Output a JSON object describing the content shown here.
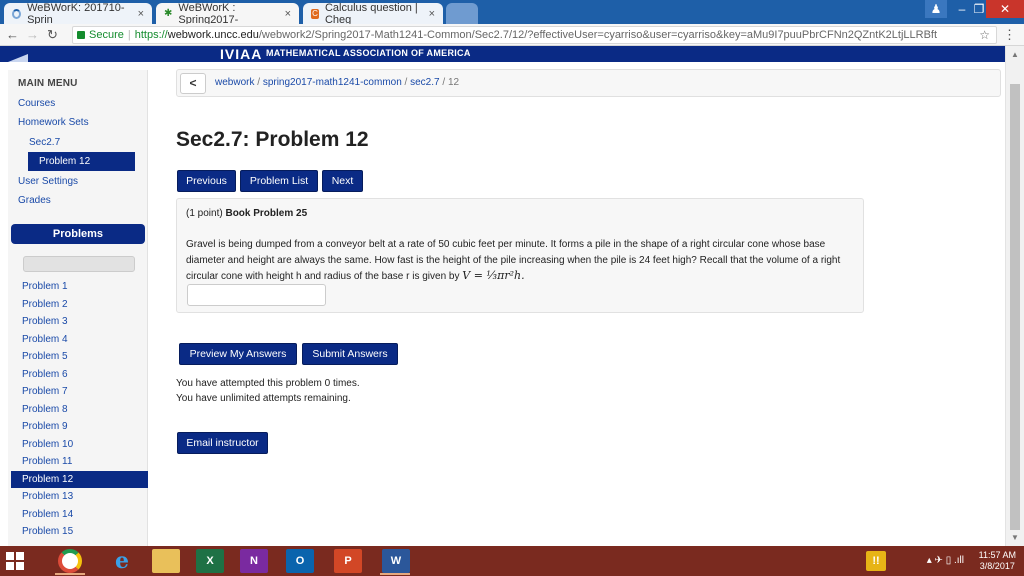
{
  "browser": {
    "tabs": [
      {
        "label": "WeBWorK: 201710-Sprin",
        "close": "×"
      },
      {
        "label": "WeBWorK : Spring2017-",
        "close": "×"
      },
      {
        "label": "Calculus question | Cheg",
        "close": "×"
      }
    ],
    "address": {
      "secure_label": "Secure",
      "separator": "|",
      "url_scheme": "https://",
      "url_host": "webwork.uncc.edu",
      "url_path": "/webwork2/Spring2017-Math1241-Common/Sec2.7/12/?effectiveUser=cyarriso&user=cyarriso&key=aMu9I7puuPbrCFNn2QZntK2LtjLLRBft"
    },
    "nav_icons": [
      "back-icon",
      "forward-icon",
      "reload-icon"
    ]
  },
  "banner": {
    "logo_text": "IVIAA",
    "text": "MATHEMATICAL ASSOCIATION OF AMERICA"
  },
  "sidebar": {
    "title": "MAIN MENU",
    "courses": "Courses",
    "homework_sets": "Homework Sets",
    "sec": "Sec2.7",
    "current_problem": "Problem 12",
    "user_settings": "User Settings",
    "grades": "Grades",
    "problems_header": "Problems",
    "problem_list": [
      "Problem 1",
      "Problem 2",
      "Problem 3",
      "Problem 4",
      "Problem 5",
      "Problem 6",
      "Problem 7",
      "Problem 8",
      "Problem 9",
      "Problem 10",
      "Problem 11",
      "Problem 12",
      "Problem 13",
      "Problem 14",
      "Problem 15"
    ],
    "active_index": 11
  },
  "main": {
    "breadcrumb": {
      "back": "<",
      "webwork": "webwork",
      "sep": " / ",
      "course": "spring2017-math1241-common",
      "set": "sec2.7",
      "problem": "12"
    },
    "title": "Sec2.7: Problem 12",
    "buttons": {
      "previous": "Previous",
      "problem_list": "Problem List",
      "next": "Next",
      "preview": "Preview My Answers",
      "submit": "Submit Answers",
      "email": "Email instructor"
    },
    "problem": {
      "points": "(1 point)",
      "source": "Book Problem 25",
      "text": "Gravel is being dumped from a conveyor belt at a rate of 50 cubic feet per minute. It forms a pile in the shape of a right circular cone whose base diameter and height are always the same. How fast is the height of the pile increasing when the pile is 24 feet high? Recall that the volume of a right circular cone with height h and radius of the base r is given by",
      "formula": "V = ⅓πr²h.",
      "answer_value": ""
    },
    "attempts": "You have attempted this problem 0 times.",
    "remaining": "You have unlimited attempts remaining."
  },
  "taskbar": {
    "time": "11:57 AM",
    "date": "3/8/2017",
    "apps": [
      "chrome-icon",
      "ie-icon",
      "file-explorer-icon",
      "excel-icon",
      "onenote-icon",
      "outlook-icon",
      "powerpoint-icon",
      "word-icon"
    ]
  }
}
